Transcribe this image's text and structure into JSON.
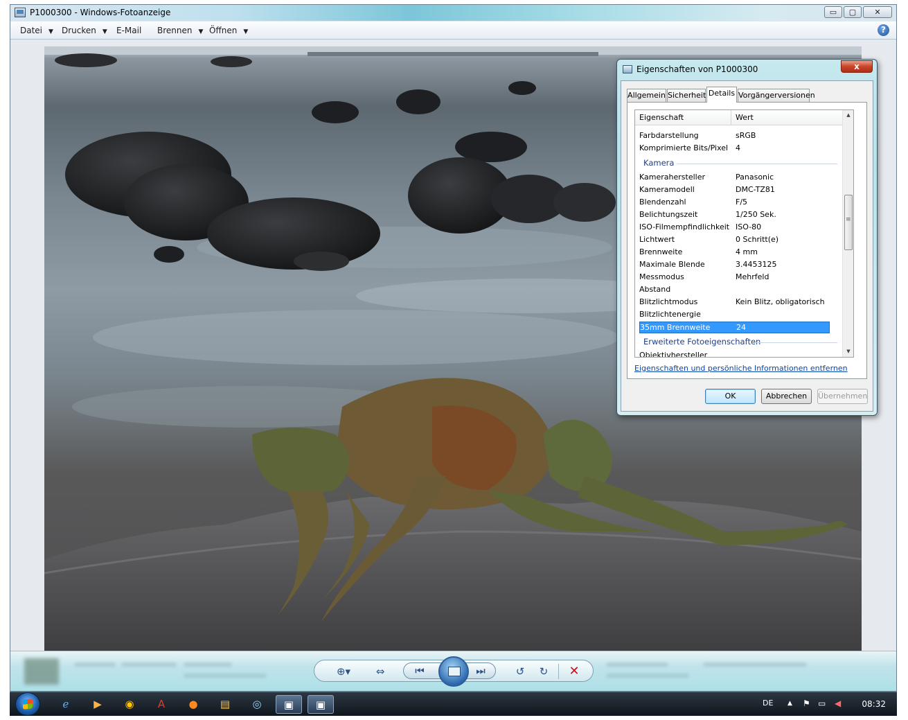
{
  "window": {
    "title": "P1000300 - Windows-Fotoanzeige",
    "controls": {
      "minimize": "▭",
      "maximize": "▢",
      "close": "✕"
    }
  },
  "menu": {
    "items": [
      {
        "label": "Datei",
        "has_dropdown": true
      },
      {
        "label": "Drucken",
        "has_dropdown": true
      },
      {
        "label": "E-Mail",
        "has_dropdown": false
      },
      {
        "label": "Brennen",
        "has_dropdown": true
      },
      {
        "label": "Öffnen",
        "has_dropdown": true
      }
    ],
    "help": "?"
  },
  "controls": {
    "zoom_icon": "magnifier-plus-icon",
    "fit_icon": "fit-window-icon",
    "prev_icon": "previous-icon",
    "slideshow_icon": "slideshow-icon",
    "next_icon": "next-icon",
    "rotate_left_icon": "rotate-ccw-icon",
    "rotate_right_icon": "rotate-cw-icon",
    "delete_icon": "delete-icon"
  },
  "dialog": {
    "title": "Eigenschaften von P1000300",
    "tabs": [
      {
        "label": "Allgemein",
        "selected": false
      },
      {
        "label": "Sicherheit",
        "selected": false
      },
      {
        "label": "Details",
        "selected": true
      },
      {
        "label": "Vorgängerversionen",
        "selected": false
      }
    ],
    "columns": {
      "property": "Eigenschaft",
      "value": "Wert"
    },
    "rows_top": [
      {
        "key": "Farbdarstellung",
        "value": "sRGB"
      },
      {
        "key": "Komprimierte Bits/Pixel",
        "value": "4"
      }
    ],
    "group_camera": "Kamera",
    "rows_camera": [
      {
        "key": "Kamerahersteller",
        "value": "Panasonic"
      },
      {
        "key": "Kameramodell",
        "value": "DMC-TZ81"
      },
      {
        "key": "Blendenzahl",
        "value": "F/5"
      },
      {
        "key": "Belichtungszeit",
        "value": "1/250 Sek."
      },
      {
        "key": "ISO-Filmempfindlichkeit",
        "value": "ISO-80"
      },
      {
        "key": "Lichtwert",
        "value": "0 Schritt(e)"
      },
      {
        "key": "Brennweite",
        "value": "4 mm"
      },
      {
        "key": "Maximale Blende",
        "value": "3.4453125"
      },
      {
        "key": "Messmodus",
        "value": "Mehrfeld"
      },
      {
        "key": "Abstand",
        "value": ""
      },
      {
        "key": "Blitzlichtmodus",
        "value": "Kein Blitz, obligatorisch"
      },
      {
        "key": "Blitzlichtenergie",
        "value": ""
      },
      {
        "key": "35mm Brennweite",
        "value": "24",
        "selected": true
      }
    ],
    "group_extended": "Erweiterte Fotoeigenschaften",
    "row_cut": "Objektivhersteller",
    "remove_link": "Eigenschaften und persönliche Informationen entfernen",
    "buttons": {
      "ok": "OK",
      "cancel": "Abbrechen",
      "apply": "Übernehmen"
    }
  },
  "taskbar": {
    "language": "DE",
    "clock": "08:32"
  }
}
